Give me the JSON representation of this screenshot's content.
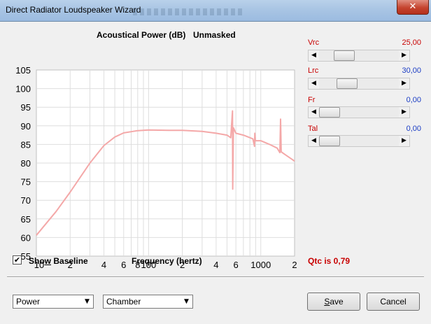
{
  "window": {
    "title": "Direct Radiator Loudspeaker Wizard",
    "close_glyph": "✕"
  },
  "chart_data": {
    "type": "line",
    "title": "Acoustical Power (dB)",
    "subtitle": "Unmasked",
    "xlabel": "Frequency (hertz)",
    "ylabel": "",
    "x_scale": "log",
    "xlim": [
      10,
      2000
    ],
    "ylim": [
      55,
      105
    ],
    "y_ticks": [
      105,
      100,
      95,
      90,
      85,
      80,
      75,
      70,
      65,
      60,
      55
    ],
    "x_major_ticks": [
      10,
      100,
      1000
    ],
    "x_tick_labels": [
      {
        "value": 10,
        "label": "10"
      },
      {
        "value": 20,
        "label": "2"
      },
      {
        "value": 40,
        "label": "4"
      },
      {
        "value": 60,
        "label": "6"
      },
      {
        "value": 80,
        "label": "8"
      },
      {
        "value": 100,
        "label": "100"
      },
      {
        "value": 200,
        "label": "2"
      },
      {
        "value": 400,
        "label": "4"
      },
      {
        "value": 600,
        "label": "6"
      },
      {
        "value": 1000,
        "label": "1000"
      },
      {
        "value": 2000,
        "label": "2"
      }
    ],
    "grid": true,
    "line_color": "#f4a8a8",
    "series": [
      {
        "points": [
          [
            10,
            60.6
          ],
          [
            15,
            67.0
          ],
          [
            20,
            72.2
          ],
          [
            30,
            80.0
          ],
          [
            40,
            84.7
          ],
          [
            50,
            87.0
          ],
          [
            60,
            88.1
          ],
          [
            80,
            88.7
          ],
          [
            100,
            88.9
          ],
          [
            150,
            88.8
          ],
          [
            200,
            88.8
          ],
          [
            300,
            88.5
          ],
          [
            400,
            88.0
          ],
          [
            500,
            87.5
          ],
          [
            540,
            86.8
          ],
          [
            560,
            94.0
          ],
          [
            562,
            73.0
          ],
          [
            570,
            89.5
          ],
          [
            600,
            88.0
          ],
          [
            700,
            87.5
          ],
          [
            850,
            86.5
          ],
          [
            880,
            84.5
          ],
          [
            885,
            88.0
          ],
          [
            895,
            86.0
          ],
          [
            1000,
            86.0
          ],
          [
            1200,
            85.0
          ],
          [
            1400,
            84.0
          ],
          [
            1480,
            82.8
          ],
          [
            1500,
            91.8
          ],
          [
            1520,
            83.0
          ],
          [
            1700,
            82.0
          ],
          [
            1900,
            81.0
          ],
          [
            2000,
            80.5
          ]
        ]
      }
    ]
  },
  "params": [
    {
      "label": "Vrc",
      "value": "25,00",
      "value_color": "#c80000",
      "position": 0.25
    },
    {
      "label": "Lrc",
      "value": "30,00",
      "value_color": "#1a3cc4",
      "position": 0.3
    },
    {
      "label": "Fr",
      "value": "0,00",
      "value_color": "#1a3cc4",
      "position": 0.0
    },
    {
      "label": "Tal",
      "value": "0,00",
      "value_color": "#1a3cc4",
      "position": 0.0
    }
  ],
  "scroll_arrows": {
    "left": "◀",
    "right": "▶"
  },
  "baseline": {
    "checked": true,
    "check_glyph": "✔",
    "label_pre": "Sho",
    "label_accel": "w",
    "label_post": " Baseline"
  },
  "qtc_text": "Qtc is 0,79",
  "selects": {
    "power": {
      "value": "Power"
    },
    "chamber": {
      "value": "Chamber"
    },
    "arrow_glyph": "▼"
  },
  "buttons": {
    "save_accel": "S",
    "save_rest": "ave",
    "cancel": "Cancel"
  }
}
